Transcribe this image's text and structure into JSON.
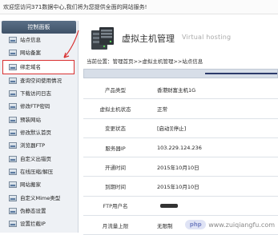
{
  "topbar": {
    "text": "欢迎您访问371数据中心,我们将为您提供全面的网站服务!"
  },
  "sidebar": {
    "title": "控制面板",
    "items": [
      {
        "label": "站点信息",
        "highlight": false
      },
      {
        "label": "网站备案",
        "highlight": false
      },
      {
        "label": "绑定域名",
        "highlight": true
      },
      {
        "label": "查询空间使用情况",
        "highlight": false
      },
      {
        "label": "下载访问日志",
        "highlight": false
      },
      {
        "label": "修改FTP密码",
        "highlight": false
      },
      {
        "label": "预装网站",
        "highlight": false
      },
      {
        "label": "修改默认首页",
        "highlight": false
      },
      {
        "label": "浏览器FTP",
        "highlight": false
      },
      {
        "label": "自定义出错页",
        "highlight": false
      },
      {
        "label": "在线压缩/解压",
        "highlight": false
      },
      {
        "label": "网站搬家",
        "highlight": false
      },
      {
        "label": "自定义Mime类型",
        "highlight": false
      },
      {
        "label": "伪静态设置",
        "highlight": false
      },
      {
        "label": "设置拦截IP",
        "highlight": false
      }
    ]
  },
  "banner": {
    "title": "虚拟主机管理",
    "subtitle": "Virtual hosting"
  },
  "breadcrumb": "当前位置：管理首页>>虚拟主机管理>>站点信息",
  "table": {
    "rows": [
      {
        "label": "产品类型",
        "value": "香港财富主机1G"
      },
      {
        "label": "虚拟主机状态",
        "value": "正常"
      },
      {
        "label": "变更状态",
        "value": "[启动][停止]"
      },
      {
        "label": "服务器IP",
        "value": "103.229.124.236"
      },
      {
        "label": "开通时间",
        "value": "2015年10月10日"
      },
      {
        "label": "到期时间",
        "value": "2015年10月10日"
      },
      {
        "label": "FTP用户名",
        "value": "",
        "masked": true
      },
      {
        "label": "月流量上限",
        "value": "无限制"
      }
    ]
  },
  "watermark": {
    "badge": "php",
    "site": "www.zuiqiangfu.com"
  },
  "colors": {
    "highlight_border": "#d93030",
    "sidebar_bg": "#eef1f5",
    "section_rule": "#2b3a6b"
  }
}
